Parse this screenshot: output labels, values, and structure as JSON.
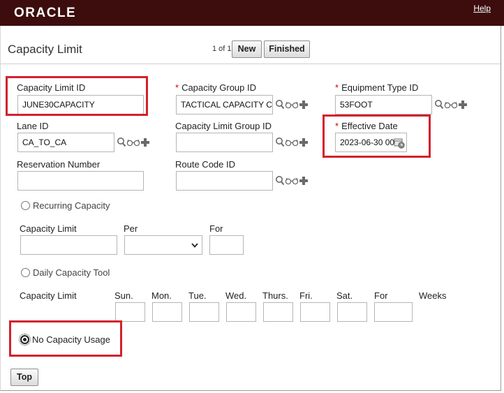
{
  "header": {
    "logo": "ORACLE",
    "help": "Help"
  },
  "page": {
    "title": "Capacity Limit"
  },
  "pager": {
    "text": "1 of 1",
    "new_label": "New",
    "finished_label": "Finished"
  },
  "fields": {
    "capacity_limit_id": {
      "label": "Capacity Limit ID",
      "value": "JUNE30CAPACITY"
    },
    "capacity_group_id": {
      "label": "Capacity Group ID",
      "value": "TACTICAL CAPACITY C"
    },
    "equipment_type_id": {
      "label": "Equipment Type ID",
      "value": "53FOOT"
    },
    "lane_id": {
      "label": "Lane ID",
      "value": "CA_TO_CA"
    },
    "capacity_limit_group_id": {
      "label": "Capacity Limit Group ID",
      "value": ""
    },
    "effective_date": {
      "label": "Effective Date",
      "value": "2023-06-30 00:"
    },
    "reservation_number": {
      "label": "Reservation Number",
      "value": ""
    },
    "route_code_id": {
      "label": "Route Code ID",
      "value": ""
    }
  },
  "recurring": {
    "radio_label": "Recurring Capacity",
    "capacity_limit_label": "Capacity Limit",
    "per_label": "Per",
    "for_label": "For",
    "capacity_limit_value": "",
    "per_value": "",
    "for_value": ""
  },
  "daily": {
    "radio_label": "Daily Capacity Tool",
    "capacity_limit_label": "Capacity Limit",
    "days": [
      "Sun.",
      "Mon.",
      "Tue.",
      "Wed.",
      "Thurs.",
      "Fri.",
      "Sat."
    ],
    "for_label": "For",
    "weeks_label": "Weeks"
  },
  "no_usage": {
    "radio_label": "No Capacity Usage"
  },
  "footer": {
    "top_label": "Top"
  },
  "colors": {
    "header_bg": "#3d0d0d",
    "highlight": "#d3212d",
    "required": "#d40000"
  }
}
